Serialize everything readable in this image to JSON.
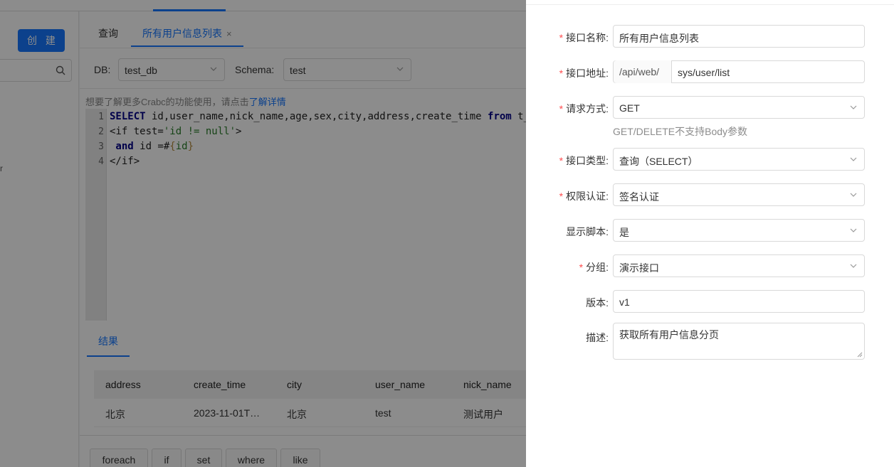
{
  "sidebar": {
    "create_label": "创 建",
    "fragment": "r"
  },
  "tabs": [
    {
      "label": "查询"
    },
    {
      "label": "所有用户信息列表",
      "close": "×"
    }
  ],
  "dbbar": {
    "db_label": "DB:",
    "db_value": "test_db",
    "schema_label": "Schema:",
    "schema_value": "test"
  },
  "hint": {
    "text": "想要了解更多Crabc的功能使用，请点击",
    "link": "了解详情"
  },
  "editor": {
    "line_numbers": [
      "1",
      "2",
      "3",
      "4"
    ],
    "line1_kw1": "SELECT",
    "line1_mid": " id,user_name,nick_name,age,sex,city,address,create_time ",
    "line1_kw2": "from",
    "line1_tail": " t_",
    "line2_a": "<if test=",
    "line2_str": "'id != null'",
    "line2_b": ">",
    "line3_kw": " and",
    "line3_a": " id =#",
    "line3_b1": "{",
    "line3_b2": "id",
    "line3_b3": "}",
    "line4": "</if>"
  },
  "results": {
    "tab_label": "结果",
    "columns": [
      "address",
      "create_time",
      "city",
      "user_name",
      "nick_name"
    ],
    "rows": [
      [
        "北京",
        "2023-11-01T…",
        "北京",
        "test",
        "测试用户"
      ]
    ]
  },
  "snippets": [
    "foreach",
    "if",
    "set",
    "where",
    "like"
  ],
  "form": {
    "name_label": "接口名称:",
    "name_value": "所有用户信息列表",
    "path_label": "接口地址:",
    "path_prefix": "/api/web/",
    "path_value": "sys/user/list",
    "method_label": "请求方式:",
    "method_value": "GET",
    "method_help": "GET/DELETE不支持Body参数",
    "type_label": "接口类型:",
    "type_value": "查询（SELECT）",
    "auth_label": "权限认证:",
    "auth_value": "签名认证",
    "script_label": "显示脚本:",
    "script_value": "是",
    "group_label": "分组:",
    "group_value": "演示接口",
    "version_label": "版本:",
    "version_value": "v1",
    "desc_label": "描述:",
    "desc_value": "获取所有用户信息分页"
  },
  "colors": {
    "primary": "#1677ff",
    "required": "#ff4d4f"
  }
}
